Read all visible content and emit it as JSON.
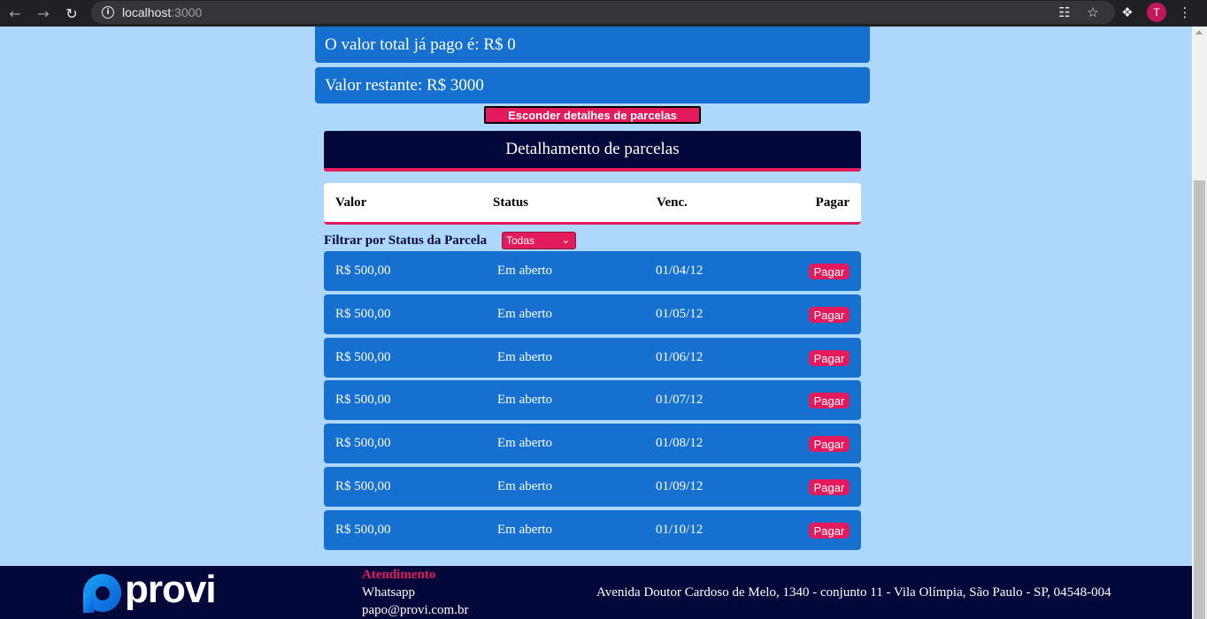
{
  "browser": {
    "url_host": "localhost",
    "url_port": ":3000",
    "profile_initial": "T"
  },
  "summary": {
    "paid_total": "O valor total já pago é: R$ 0",
    "remaining": "Valor restante: R$ 3000"
  },
  "toggle_button_label": "Esconder detalhes de parcelas",
  "detail_title": "Detalhamento de parcelas",
  "table": {
    "columns": [
      "Valor",
      "Status",
      "Venc.",
      "Pagar"
    ],
    "filter_label": "Filtrar por Status da Parcela",
    "filter_selected": "Todas",
    "pay_label": "Pagar",
    "rows": [
      {
        "valor": "R$ 500,00",
        "status": "Em aberto",
        "venc": "01/04/12"
      },
      {
        "valor": "R$ 500,00",
        "status": "Em aberto",
        "venc": "01/05/12"
      },
      {
        "valor": "R$ 500,00",
        "status": "Em aberto",
        "venc": "01/06/12"
      },
      {
        "valor": "R$ 500,00",
        "status": "Em aberto",
        "venc": "01/07/12"
      },
      {
        "valor": "R$ 500,00",
        "status": "Em aberto",
        "venc": "01/08/12"
      },
      {
        "valor": "R$ 500,00",
        "status": "Em aberto",
        "venc": "01/09/12"
      },
      {
        "valor": "R$ 500,00",
        "status": "Em aberto",
        "venc": "01/10/12"
      }
    ]
  },
  "footer": {
    "logo_text": "provi",
    "support_title": "Atendimento",
    "support_whatsapp": "Whatsapp",
    "support_email": "papo@provi.com.br",
    "address": "Avenida Doutor Cardoso de Melo, 1340 - conjunto 11 - Vila Olímpia, São Paulo - SP, 04548-004"
  },
  "colors": {
    "page_bg": "#add8fb",
    "box_blue": "#1570cf",
    "navy": "#02093a",
    "accent_pink": "#e31b5c"
  }
}
